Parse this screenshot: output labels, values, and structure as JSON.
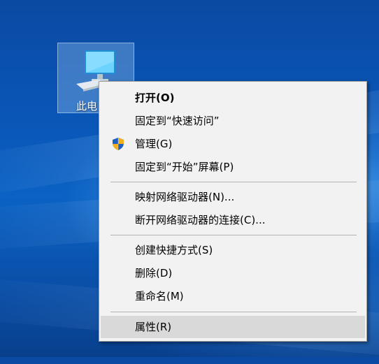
{
  "desktop": {
    "icon_label": "此电"
  },
  "context_menu": {
    "items": [
      {
        "label": "打开(O)"
      },
      {
        "label": "固定到“快速访问”"
      },
      {
        "label": "管理(G)"
      },
      {
        "label": "固定到“开始”屏幕(P)"
      },
      {
        "label": "映射网络驱动器(N)..."
      },
      {
        "label": "断开网络驱动器的连接(C)..."
      },
      {
        "label": "创建快捷方式(S)"
      },
      {
        "label": "删除(D)"
      },
      {
        "label": "重命名(M)"
      },
      {
        "label": "属性(R)"
      }
    ],
    "default_item": "打开(O)",
    "highlighted_item": "属性(R)",
    "icons": {
      "manage": "uac-shield-icon"
    }
  },
  "colors": {
    "menu_background": "#f2f2f2",
    "menu_highlight": "#d9d9d9",
    "desktop_blue": "#0a57b8"
  }
}
